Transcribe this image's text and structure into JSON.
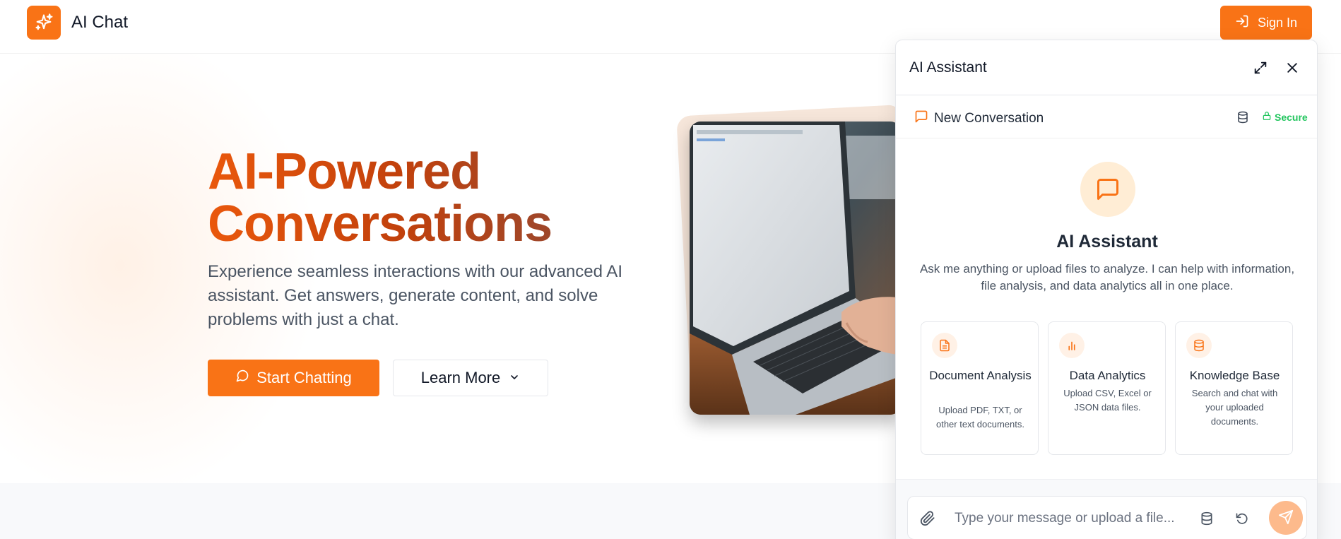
{
  "colors": {
    "accent": "#f97316",
    "accent_light": "#ffedd5",
    "secure_green": "#22c55e",
    "text_dark": "#111827",
    "text_muted": "#4b5563"
  },
  "header": {
    "logo_icon": "sparkles-icon",
    "app_title": "AI Chat",
    "signin_icon": "log-in-icon",
    "signin_label": "Sign In"
  },
  "hero": {
    "title_line1": "AI-Powered",
    "title_line2": "Conversations",
    "description": "Experience seamless interactions with our advanced AI assistant. Get answers, generate content, and solve problems with just a chat.",
    "start_button": {
      "icon": "message-circle-icon",
      "label": "Start Chatting"
    },
    "learn_button": {
      "label": "Learn More",
      "icon": "chevron-down-icon"
    },
    "image_alt": "laptop-photo"
  },
  "assistant": {
    "title": "AI Assistant",
    "header_icons": [
      "maximize-icon",
      "close-icon"
    ],
    "conversation_label": "New Conversation",
    "conversation_icon": "message-square-icon",
    "database_icon": "database-icon",
    "secure_label": "Secure",
    "secure_icon": "lock-icon",
    "welcome": {
      "icon": "message-square-icon",
      "title": "AI Assistant",
      "description": "Ask me anything or upload files to analyze. I can help with information, file analysis, and data analytics all in one place."
    },
    "cards": [
      {
        "icon": "file-text-icon",
        "title": "Document Analysis",
        "description": "Upload PDF, TXT, or other text documents."
      },
      {
        "icon": "bar-chart-icon",
        "title": "Data Analytics",
        "description": "Upload CSV, Excel or JSON data files."
      },
      {
        "icon": "database-icon",
        "title": "Knowledge Base",
        "description": "Search and chat with your uploaded documents."
      }
    ],
    "input": {
      "attach_icon": "paperclip-icon",
      "placeholder": "Type your message or upload a file...",
      "value": "",
      "database_icon": "database-icon",
      "reset_icon": "rotate-ccw-icon",
      "send_icon": "send-icon"
    }
  }
}
